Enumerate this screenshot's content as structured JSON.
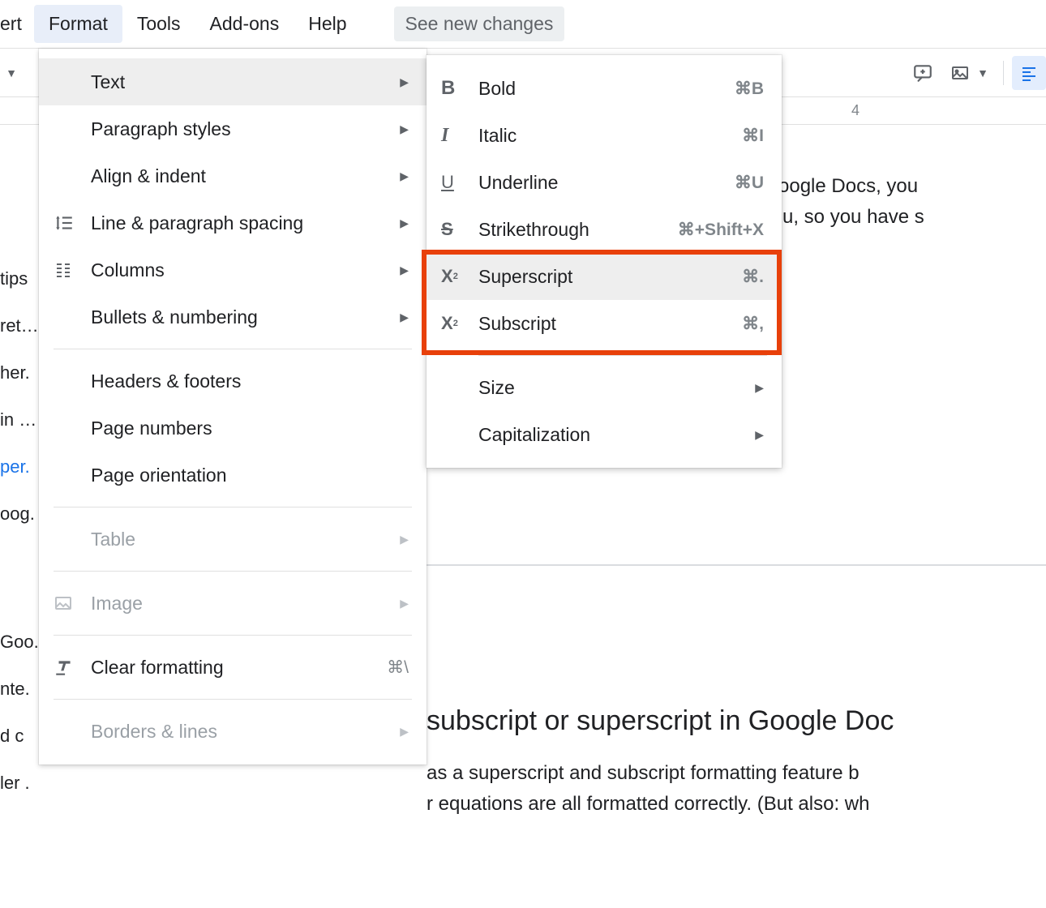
{
  "menubar": {
    "items": [
      "ert",
      "Format",
      "Tools",
      "Add-ons",
      "Help"
    ],
    "see_changes": "See new changes"
  },
  "toolbar": {
    "ruler_num": "4"
  },
  "sidebar": {
    "items": [
      "tips",
      "ret…",
      "her.",
      "in …",
      "per.",
      "oog.",
      "",
      "Goo.",
      "nte.",
      "d c",
      "ler ."
    ]
  },
  "format_menu": {
    "text": "Text",
    "paragraph_styles": "Paragraph styles",
    "align_indent": "Align & indent",
    "line_spacing": "Line & paragraph spacing",
    "columns": "Columns",
    "bullets_numbering": "Bullets & numbering",
    "headers_footers": "Headers & footers",
    "page_numbers": "Page numbers",
    "page_orientation": "Page orientation",
    "table": "Table",
    "image": "Image",
    "clear_formatting": "Clear formatting",
    "clear_shortcut": "⌘\\",
    "borders_lines": "Borders & lines"
  },
  "text_submenu": {
    "bold": {
      "label": "Bold",
      "shortcut": "⌘B"
    },
    "italic": {
      "label": "Italic",
      "shortcut": "⌘I"
    },
    "underline": {
      "label": "Underline",
      "shortcut": "⌘U"
    },
    "strikethrough": {
      "label": "Strikethrough",
      "shortcut": "⌘+Shift+X"
    },
    "superscript": {
      "label": "Superscript",
      "shortcut": "⌘."
    },
    "subscript": {
      "label": "Subscript",
      "shortcut": "⌘,"
    },
    "size": "Size",
    "capitalization": "Capitalization"
  },
  "doc": {
    "line1": "oogle Docs, you",
    "line2": "u, so you have s",
    "heading": "subscript or superscript in Google Doc",
    "body1": "as a superscript and subscript formatting feature b",
    "body2": "r equations are all formatted correctly. (But also: wh"
  }
}
